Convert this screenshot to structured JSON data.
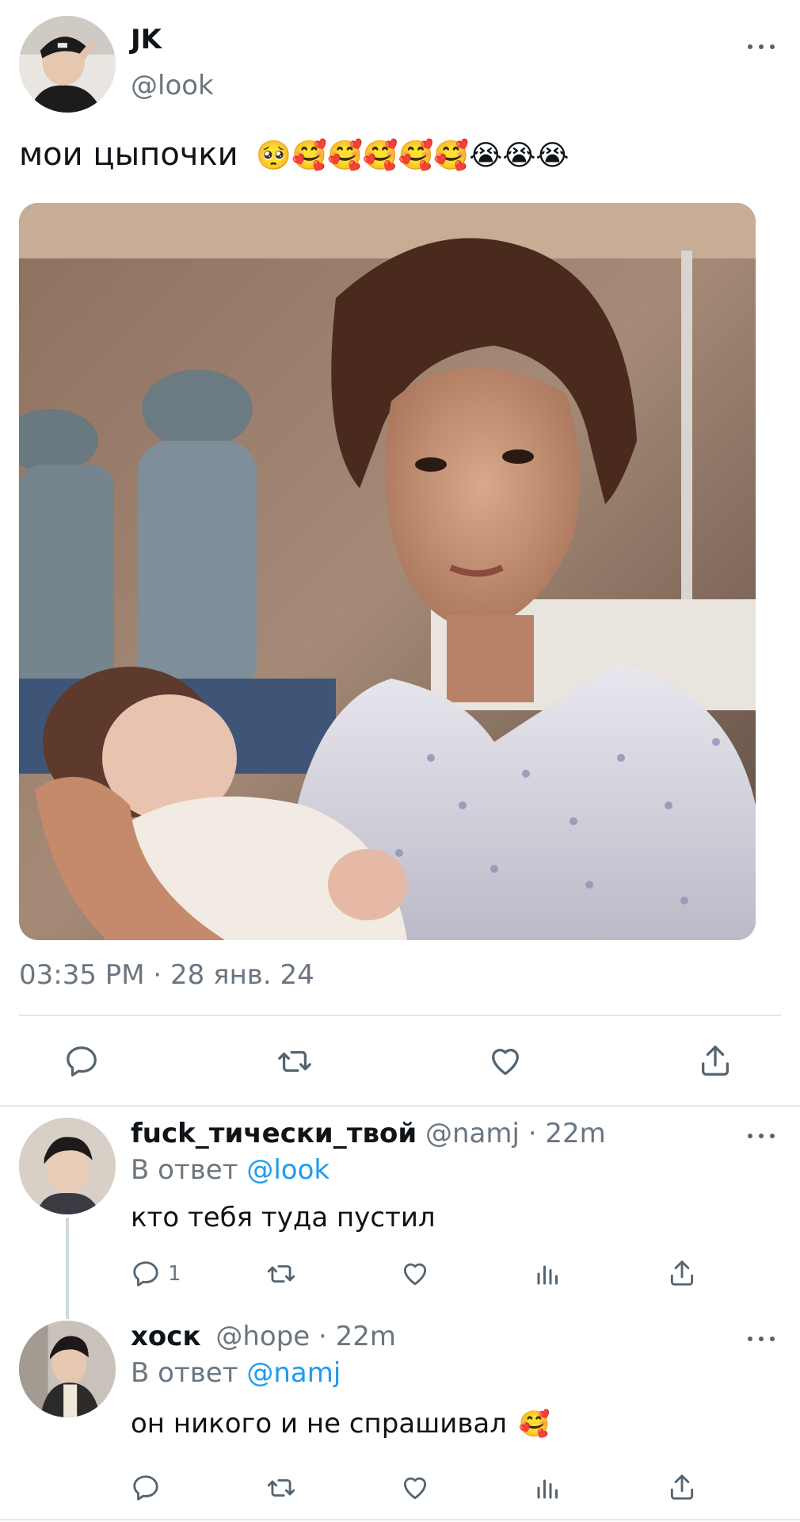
{
  "tweet": {
    "author_name": "JK",
    "author_handle": "@look",
    "text": "мои цыпочки",
    "text_emojis": "🥺🥰🥰🥰🥰🥰😭😭😭",
    "timestamp": "03:35 PM · 28 янв. 24"
  },
  "replies": [
    {
      "name": "fuck_тически_твой",
      "handle": "@namj",
      "time": "· 22m",
      "reply_prefix": "В ответ",
      "reply_to": "@look",
      "text": "кто тебя туда пустил",
      "text_emoji": "",
      "reply_count": "1"
    },
    {
      "name": "хоск",
      "handle": "@hope",
      "time": "· 22m",
      "reply_prefix": "В ответ",
      "reply_to": "@namj",
      "text": "он никого и не спрашивал",
      "text_emoji": "🥰",
      "reply_count": ""
    }
  ],
  "icons": {
    "reply": "reply-icon",
    "retweet": "retweet-icon",
    "like": "heart-icon",
    "share": "share-icon",
    "views": "views-icon",
    "more": "more-icon"
  },
  "colors": {
    "link": "#1d9bf0",
    "muted": "#6a7681",
    "icon": "#536471",
    "divider": "#e3e6e9"
  }
}
